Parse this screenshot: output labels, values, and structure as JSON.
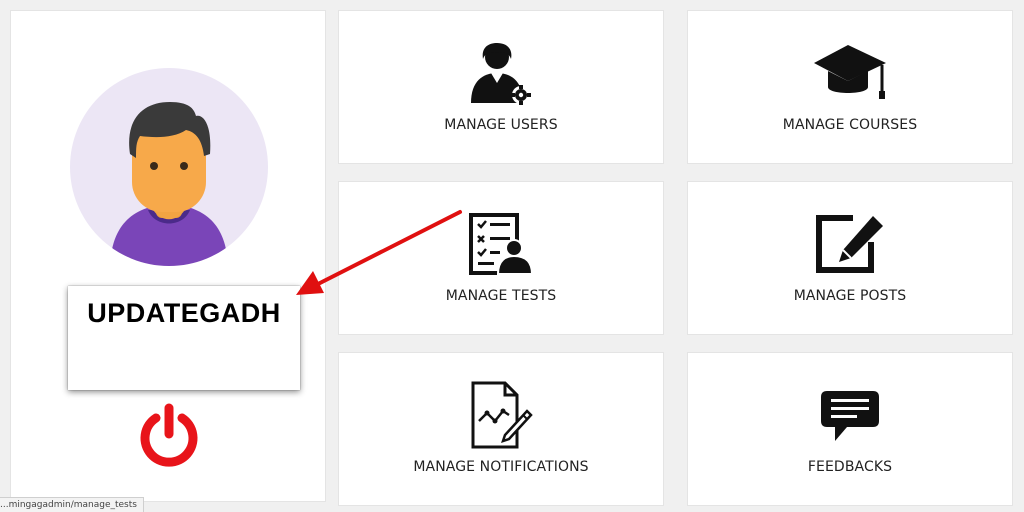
{
  "profile": {
    "username": "UPDATEGADH"
  },
  "tiles": [
    {
      "label": "MANAGE USERS",
      "icon": "user-gear-icon"
    },
    {
      "label": "MANAGE COURSES",
      "icon": "graduation-cap-icon"
    },
    {
      "label": "MANAGE TESTS",
      "icon": "test-checklist-icon"
    },
    {
      "label": "MANAGE POSTS",
      "icon": "edit-post-icon"
    },
    {
      "label": "MANAGE NOTIFICATIONS",
      "icon": "document-chart-pen-icon"
    },
    {
      "label": "FEEDBACKS",
      "icon": "chat-bubble-icon"
    }
  ],
  "status_bar": {
    "url": "...mingagadmin/manage_tests"
  },
  "colors": {
    "background": "#f0f0f0",
    "card": "#ffffff",
    "power": "#e8141a",
    "arrow": "#e01010",
    "avatar_bg": "#ece6f5",
    "avatar_shirt": "#7a45b8",
    "avatar_skin": "#f7a94a",
    "avatar_hair": "#3a3a3a"
  }
}
